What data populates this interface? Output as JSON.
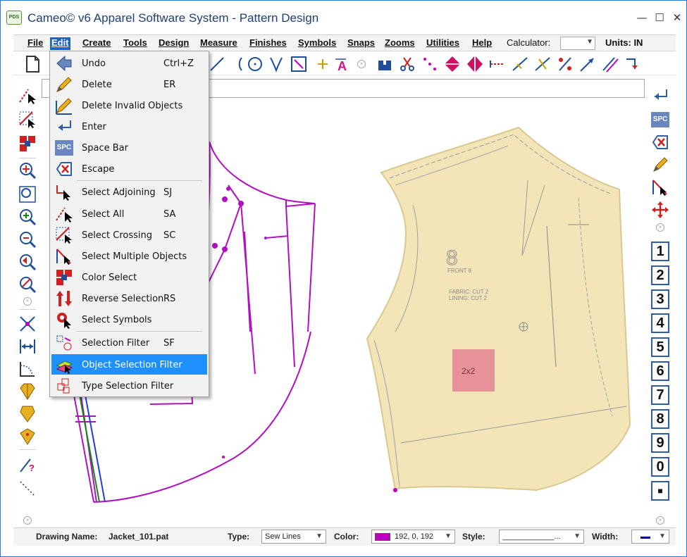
{
  "window": {
    "title": "Cameo© v6 Apparel Software System - Pattern Design",
    "app_icon_text": "PDS",
    "minimize": "—",
    "maximize": "☐",
    "close": "✕"
  },
  "menubar": {
    "items": [
      {
        "label": "File",
        "active": false
      },
      {
        "label": "Edit",
        "active": true
      },
      {
        "label": "Create",
        "active": false
      },
      {
        "label": "Tools",
        "active": false
      },
      {
        "label": "Design",
        "active": false
      },
      {
        "label": "Measure",
        "active": false
      },
      {
        "label": "Finishes",
        "active": false
      },
      {
        "label": "Symbols",
        "active": false
      },
      {
        "label": "Snaps",
        "active": false
      },
      {
        "label": "Zooms",
        "active": false
      },
      {
        "label": "Utilities",
        "active": false
      },
      {
        "label": "Help",
        "active": false
      }
    ],
    "calculator_label": "Calculator:",
    "calculator_value": "",
    "units": "Units: IN"
  },
  "edit_menu": {
    "items": [
      {
        "label": "Undo",
        "shortcut": "Ctrl+Z",
        "icon": "undo-arrow-icon"
      },
      {
        "label": "Delete",
        "shortcut": "ER",
        "icon": "pencil-eraser-icon"
      },
      {
        "label": "Delete Invalid Objects",
        "shortcut": "",
        "icon": "pencil-invalid-icon"
      },
      {
        "label": "Enter",
        "shortcut": "",
        "icon": "enter-key-icon"
      },
      {
        "label": "Space Bar",
        "shortcut": "",
        "icon": "spc-key-icon"
      },
      {
        "label": "Escape",
        "shortcut": "",
        "icon": "escape-x-icon"
      },
      {
        "label": "Select Adjoining",
        "shortcut": "SJ",
        "icon": "select-adjoining-icon"
      },
      {
        "label": "Select All",
        "shortcut": "SA",
        "icon": "select-all-icon"
      },
      {
        "label": "Select Crossing",
        "shortcut": "SC",
        "icon": "select-crossing-icon"
      },
      {
        "label": "Select Multiple Objects",
        "shortcut": "",
        "icon": "select-multiple-icon"
      },
      {
        "label": "Color Select",
        "shortcut": "",
        "icon": "color-select-icon"
      },
      {
        "label": "Reverse Selection",
        "shortcut": "RS",
        "icon": "reverse-selection-icon"
      },
      {
        "label": "Select Symbols",
        "shortcut": "",
        "icon": "select-symbols-icon"
      },
      {
        "label": "Selection Filter",
        "shortcut": "SF",
        "icon": "selection-filter-icon"
      },
      {
        "label": "Object Selection Filter",
        "shortcut": "",
        "icon": "object-selection-filter-icon",
        "highlighted": true
      },
      {
        "label": "Type Selection Filter",
        "shortcut": "",
        "icon": "type-selection-filter-icon"
      }
    ]
  },
  "right_toolbar": {
    "spc_label": "SPC",
    "number_keys": [
      "1",
      "2",
      "3",
      "4",
      "5",
      "6",
      "7",
      "8",
      "9",
      "0",
      "■"
    ]
  },
  "pattern": {
    "piece_label_large": "8",
    "piece_name": "FRONT 8",
    "fabric_text": "FABRIC: CUT 2",
    "lining_text": "LINING: CUT 2",
    "swatch_label": "2x2"
  },
  "statusbar": {
    "drawing_name_label": "Drawing Name:",
    "drawing_name": "Jacket_101.pat",
    "type_label": "Type:",
    "type_value": "Sew Lines",
    "color_label": "Color:",
    "color_value": "192, 0, 192",
    "color_hex": "#c000c0",
    "style_label": "Style:",
    "style_value": "____________...",
    "width_label": "Width:"
  },
  "colors": {
    "accent": "#1f63c9",
    "pattern_line": "#b010c0",
    "menu_highlight": "#1e90ff",
    "paper": "#f3e5b8"
  }
}
